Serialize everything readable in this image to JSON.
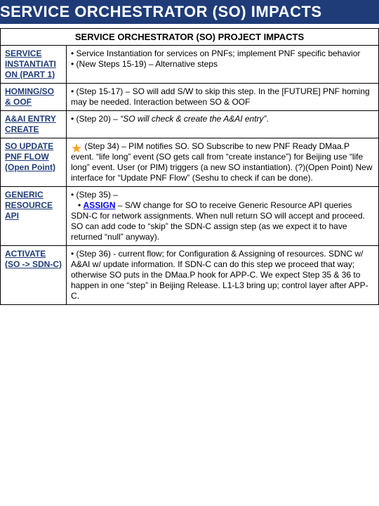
{
  "title": "SERVICE ORCHESTRATOR (SO) IMPACTS",
  "table_header": "SERVICE ORCHESTRATOR (SO) PROJECT IMPACTS",
  "rows": [
    {
      "label": "SERVICE INSTANTIATI ON (PART 1)",
      "desc_html": "• Service Instantiation for services on PNFs; implement PNF specific behavior<br>• (New Steps 15-19) – Alternative steps"
    },
    {
      "label": "HOMING/SO & OOF",
      "desc_html": "• (Step 15-17) – SO will add S/W to skip this step. In the [FUTURE] PNF homing may be needed. Interaction between SO & OOF"
    },
    {
      "label": "A&AI ENTRY CREATE",
      "desc_html": "• (Step 20) – <i>“SO will check &amp; create the A&amp;AI entry”</i>."
    },
    {
      "label": "SO UPDATE PNF FLOW (Open Point)",
      "star": true,
      "desc_html": "• (Step 34) – PIM notifies SO. SO Subscribe to new PNF Ready DMaa.P event. “life long” event (SO gets call from “create instance”) for Beijing use “life long” event. User (or PIM) triggers (a new SO instantiation). (?)(Open Point) New interface for “Update PNF Flow” (Seshu to check if can be done)."
    },
    {
      "label": "GENERIC RESOURCE API",
      "desc_html": "• (Step 35) –<br>&nbsp;&nbsp;&nbsp;• <span class=\"assign-link\">ASSIGN</span> – S/W change for SO to receive Generic Resource API queries SDN-C for network assignments. When null return SO will accept and proceed. SO can add code to “skip” the SDN-C assign step (as we expect it to have returned “null” anyway)."
    },
    {
      "label": "ACTIVATE (SO -> SDN-C)",
      "desc_html": "• (Step 36) - current flow; for Configuration &amp; Assigning of resources. SDNC w/ A&amp;AI w/ update information. If SDN-C can do this step we proceed that way; otherwise SO puts in the DMaa.P hook for APP-C. We expect Step 35 &amp; 36 to happen in one “step” in Beijing Release. L1-L3 bring up; control layer after APP-C."
    }
  ]
}
